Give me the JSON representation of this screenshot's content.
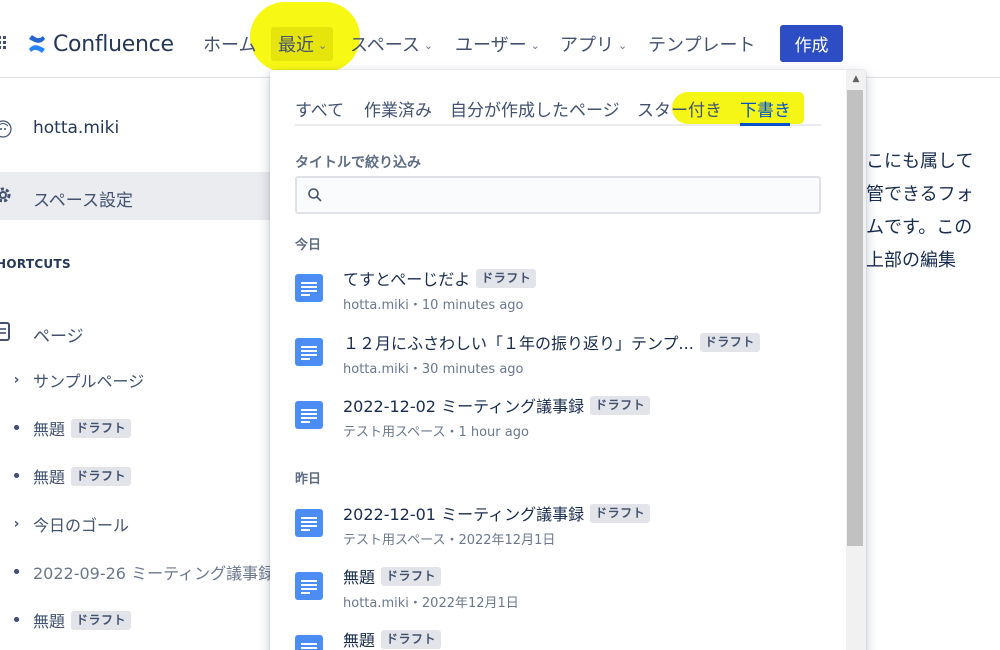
{
  "topnav": {
    "logo_text": "Confluence",
    "items": [
      {
        "label": "ホーム"
      },
      {
        "label": "最近"
      },
      {
        "label": "スペース"
      },
      {
        "label": "ユーザー"
      },
      {
        "label": "アプリ"
      },
      {
        "label": "テンプレート"
      }
    ],
    "create_label": "作成",
    "chevron": "⌄",
    "brand_color": "#2c4dc3"
  },
  "sidebar": {
    "user_name": "hotta.miki",
    "space_settings_label": "スペース設定",
    "shortcuts_label": "HORTCUTS",
    "pages_label": "ページ",
    "tree": [
      {
        "type": "caret",
        "label": "サンプルページ"
      },
      {
        "type": "bullet",
        "label": "無題",
        "badge": "ドラフト"
      },
      {
        "type": "bullet",
        "label": "無題",
        "badge": "ドラフト"
      },
      {
        "type": "caret",
        "label": "今日のゴール"
      },
      {
        "type": "bullet",
        "label": "2022-09-26 ミーティング議事録"
      },
      {
        "type": "bullet",
        "label": "無題",
        "badge": "ドラフト"
      }
    ]
  },
  "content": {
    "lines": [
      "こにも属して",
      "管できるフォ",
      "ムです。この",
      "上部の編集"
    ]
  },
  "dropdown": {
    "tabs": [
      {
        "label": "すべて"
      },
      {
        "label": "作業済み"
      },
      {
        "label": "自分が作成したページ"
      },
      {
        "label": "スター付き"
      },
      {
        "label": "下書き"
      }
    ],
    "selected_tab": "下書き",
    "filter_label": "タイトルで絞り込み",
    "filter_value": "",
    "groups": [
      {
        "label": "今日",
        "items": [
          {
            "title": "てすとぺーじだよ",
            "badge": "ドラフト",
            "meta": "hotta.miki・10 minutes ago"
          },
          {
            "title": "１２月にふさわしい「１年の振り返り」テンプ...",
            "badge": "ドラフト",
            "meta": "hotta.miki・30 minutes ago"
          },
          {
            "title": "2022-12-02 ミーティング議事録",
            "badge": "ドラフト",
            "meta": "テスト用スペース・1 hour ago"
          }
        ]
      },
      {
        "label": "昨日",
        "items": [
          {
            "title": "2022-12-01 ミーティング議事録",
            "badge": "ドラフト",
            "meta": "テスト用スペース・2022年12月1日"
          },
          {
            "title": "無題",
            "badge": "ドラフト",
            "meta": "hotta.miki・2022年12月1日"
          },
          {
            "title": "無題",
            "badge": "ドラフト",
            "meta": ""
          }
        ]
      }
    ],
    "highlight_color": "#f8f808"
  }
}
